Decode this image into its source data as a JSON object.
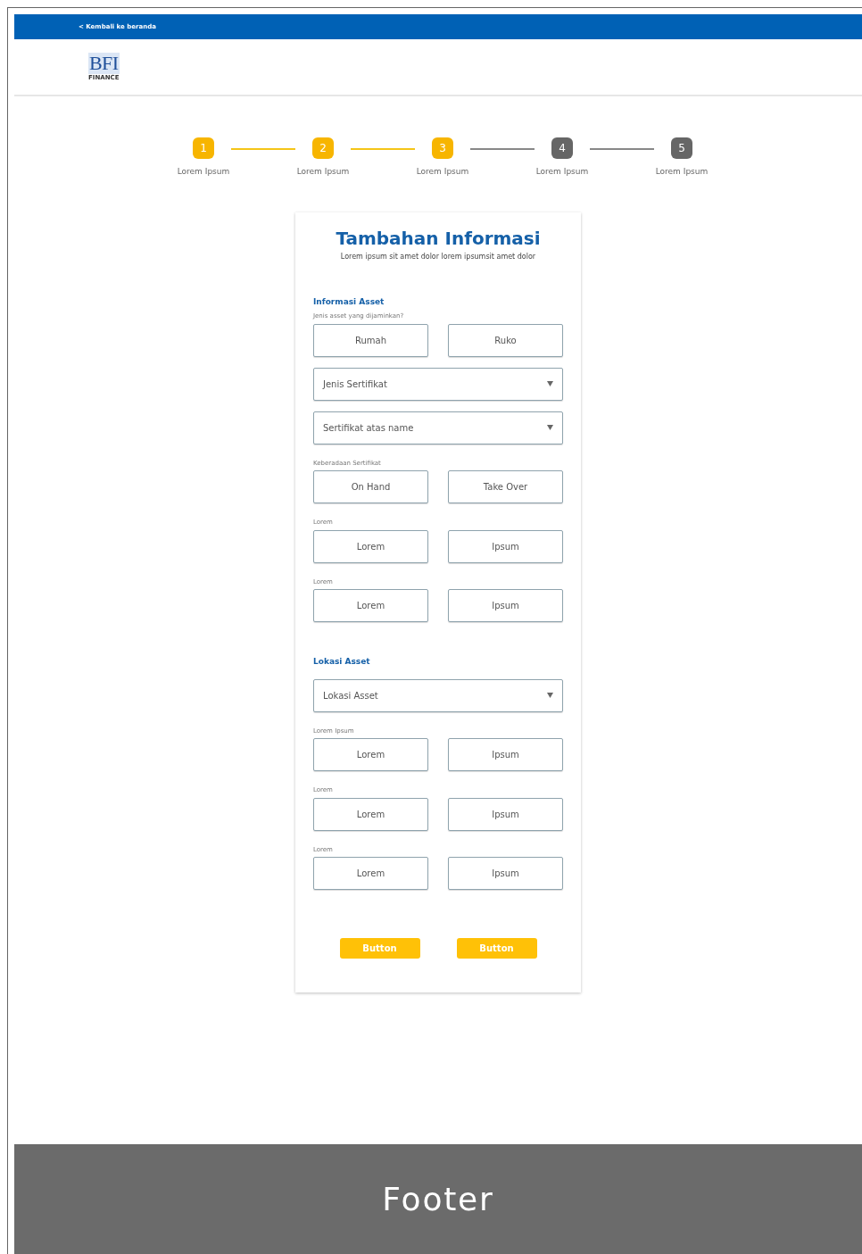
{
  "top_bar": {
    "back_link": "< Kembali ke beranda"
  },
  "logo": {
    "mark": "BFI",
    "subtitle": "FINANCE"
  },
  "steps": [
    {
      "number": "1",
      "label": "Lorem Ipsum",
      "completed": true
    },
    {
      "number": "2",
      "label": "Lorem Ipsum",
      "completed": true
    },
    {
      "number": "3",
      "label": "Lorem Ipsum",
      "completed": true
    },
    {
      "number": "4",
      "label": "Lorem Ipsum",
      "completed": false
    },
    {
      "number": "5",
      "label": "Lorem Ipsum",
      "completed": false
    }
  ],
  "card": {
    "title": "Tambahan Informasi",
    "subtitle": "Lorem ipsum sit amet dolor lorem ipsumsit amet dolor",
    "sections": [
      {
        "heading": "Informasi Asset",
        "items": [
          {
            "kind": "hint",
            "text": "Jenis asset yang dijaminkan?"
          },
          {
            "kind": "choices",
            "options": [
              "Rumah",
              "Ruko"
            ]
          },
          {
            "kind": "select",
            "placeholder": "Jenis Sertifikat"
          },
          {
            "kind": "select",
            "placeholder": "Sertifikat atas name"
          },
          {
            "kind": "hint",
            "text": "Keberadaan Sertifikat"
          },
          {
            "kind": "choices",
            "options": [
              "On Hand",
              "Take Over"
            ]
          },
          {
            "kind": "hint",
            "text": "Lorem"
          },
          {
            "kind": "choices",
            "options": [
              "Lorem",
              "Ipsum"
            ]
          },
          {
            "kind": "hint",
            "text": "Lorem"
          },
          {
            "kind": "choices",
            "options": [
              "Lorem",
              "Ipsum"
            ]
          }
        ]
      },
      {
        "heading": "Lokasi Asset",
        "items": [
          {
            "kind": "select",
            "placeholder": "Lokasi Asset"
          },
          {
            "kind": "hint",
            "text": "Lorem Ipsum"
          },
          {
            "kind": "choices",
            "options": [
              "Lorem",
              "Ipsum"
            ]
          },
          {
            "kind": "hint",
            "text": "Lorem"
          },
          {
            "kind": "choices",
            "options": [
              "Lorem",
              "Ipsum"
            ]
          },
          {
            "kind": "hint",
            "text": "Lorem"
          },
          {
            "kind": "choices",
            "options": [
              "Lorem",
              "Ipsum"
            ]
          }
        ]
      }
    ],
    "buttons": [
      "Button",
      "Button"
    ]
  },
  "footer": {
    "text": "Footer"
  }
}
